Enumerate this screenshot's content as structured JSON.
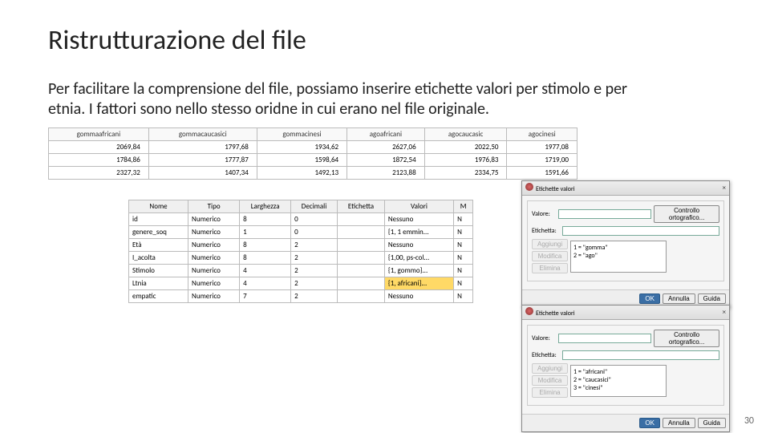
{
  "title": "Ristrutturazione del file",
  "body": "Per facilitare la comprensione del file, possiamo inserire etichette valori per stimolo e per etnia. I fattori sono nello stesso oridne in cui erano nel file originale.",
  "page_number": "30",
  "data_headers": [
    "gommaafricani",
    "gommacaucasici",
    "gommacinesi",
    "agoafricani",
    "agocaucasic",
    "agocinesi"
  ],
  "data_rows": [
    [
      "2069,84",
      "1797,68",
      "1934,62",
      "2627,06",
      "2022,50",
      "1977,08"
    ],
    [
      "1784,86",
      "1777,87",
      "1598,64",
      "1872,54",
      "1976,83",
      "1719,00"
    ],
    [
      "2327,32",
      "1407,34",
      "1492,13",
      "2123,88",
      "2334,75",
      "1591,66"
    ]
  ],
  "var_headers": [
    "Nome",
    "Tipo",
    "Larghezza",
    "Decimali",
    "Etichetta",
    "Valori"
  ],
  "var_rows": [
    {
      "cells": [
        "id",
        "Numerico",
        "8",
        "0",
        "",
        "Nessuno",
        "N"
      ],
      "sel": false
    },
    {
      "cells": [
        "genere_soq",
        "Numerico",
        "1",
        "0",
        "",
        "{1, 1 emmin...",
        "N"
      ],
      "sel": false
    },
    {
      "cells": [
        "Età",
        "Numerico",
        "8",
        "2",
        "",
        "Nessuno",
        "N"
      ],
      "sel": false
    },
    {
      "cells": [
        "I_acolta",
        "Numerico",
        "8",
        "2",
        "",
        "{1,00, ps-col...",
        "N"
      ],
      "sel": false
    },
    {
      "cells": [
        "Stimolo",
        "Numerico",
        "4",
        "2",
        "",
        "{1, gommo}...",
        "N"
      ],
      "sel": false
    },
    {
      "cells": [
        "Ltnia",
        "Numerico",
        "4",
        "2",
        "",
        "{1, africani}...",
        "N"
      ],
      "sel": true
    },
    {
      "cells": [
        "empatic",
        "Numerico",
        "7",
        "2",
        "",
        "Nessuno",
        "N"
      ],
      "sel": false
    }
  ],
  "dialog1": {
    "title": "Etichette valori",
    "label_valore": "Valore:",
    "label_etichetta": "Etichetta:",
    "input_valore": "",
    "input_etichetta": "",
    "btn_spell": "Controllo ortografico...",
    "btn_add": "Aggiungi",
    "btn_edit": "Modifica",
    "btn_del": "Elimina",
    "list": [
      "1 = \"gomma\"",
      "2 = \"ago\""
    ],
    "btn_ok": "OK",
    "btn_cancel": "Annulla",
    "btn_help": "Guida"
  },
  "dialog2": {
    "title": "Etichette valori",
    "label_valore": "Valore:",
    "label_etichetta": "Etichetta:",
    "input_valore": "",
    "input_etichetta": "",
    "btn_spell": "Controllo ortografico...",
    "btn_add": "Aggiungi",
    "btn_edit": "Modifica",
    "btn_del": "Elimina",
    "list": [
      "1 = \"africani\"",
      "2 = \"caucasici\"",
      "3 = \"cinesi\""
    ],
    "btn_ok": "OK",
    "btn_cancel": "Annulla",
    "btn_help": "Guida"
  }
}
